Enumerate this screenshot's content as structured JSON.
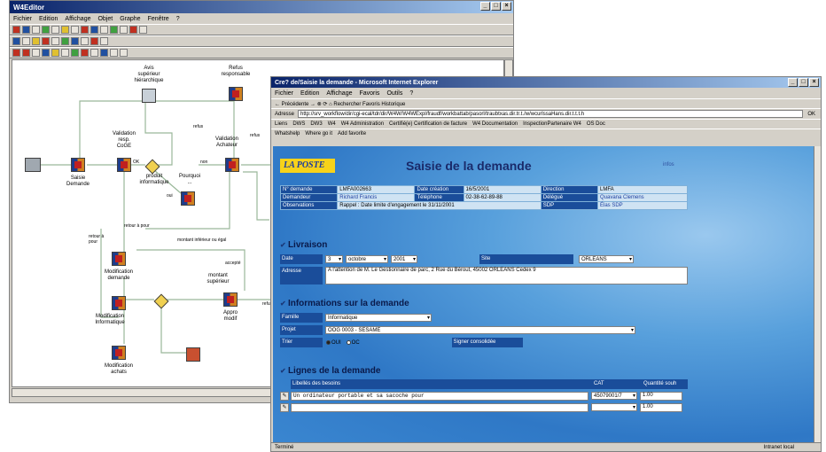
{
  "window1": {
    "title": "W4Editor",
    "menu": [
      "Fichier",
      "Edition",
      "Affichage",
      "Objet",
      "Graphe",
      "Fenêtre",
      "?"
    ],
    "nodes": {
      "saisie": "Saisie\nDemande",
      "validation_resp": "Validation\nresp.\nCoGE",
      "produit": "produit\ninformatique",
      "avis": "Avis\nsupérieur\nhiérarchique",
      "refus_resp": "Refus\nresponsable",
      "validation_achats": "Validation\nAchateur",
      "pourquoi": "Pourquoi\n...",
      "modif_demande": "Modification\ndemande",
      "modif_info": "Modification\nInformatique",
      "appro_modif": "Appro\nmodif",
      "modif_achats": "Modification\nachats",
      "montant": "montant\nsupérieur"
    },
    "edges": {
      "refus": "refus",
      "ok": "OK",
      "non": "non",
      "oui": "oui",
      "retour_a_pour": "retour à pour",
      "retour_a_pour2": "retour à\npour",
      "montant_sup": "montant inférieur ou égal",
      "accepte": "accepté",
      "refus2": "refus",
      "refus3": "refus"
    },
    "side_label": "Cou\nsup\nsi s"
  },
  "window2": {
    "title": "Cre? de/Saisie la demande - Microsoft Internet Explorer",
    "menu": [
      "Fichier",
      "Edition",
      "Affichage",
      "Favoris",
      "Outils",
      "?"
    ],
    "toolbar_text": "← Précédente  →  ⊗  ⟳  ⌂   Rechercher   Favoris   Historique",
    "address_label": "Adresse",
    "address": "http://srv_workflow/dir/cgi-ecal/tdr/dir/W4W/W4WExpl/fraudf/workbattab/pasorl/traubtxas.dir.tr.t./w/wcurlssaHans.dir.t.t.t.h",
    "go": "OK",
    "links": [
      "Liens",
      "DWS",
      "DW3",
      "W4",
      "W4 Administration",
      "Certifié(e) Certification de facture",
      "W4 Documentation",
      "InspectionPartenaire W4",
      "OS Doc"
    ],
    "links2": [
      "Whatshelp",
      "Where go it",
      "Add favorite"
    ],
    "status": "Terminé",
    "zone": "Intranet local"
  },
  "page": {
    "logo": "LA POSTE",
    "title": "Saisie de la demande",
    "small_right": "infos",
    "header_rows": [
      [
        "N° demande",
        "LMFA002663",
        "Date création",
        "16/5/2001",
        "Direction",
        "LMFA"
      ],
      [
        "Demandeur",
        "Richard Francis",
        "Téléphone",
        "02-38-62-89-88",
        "Délégué",
        "Quavana Clemens"
      ],
      [
        "Observations",
        "Rappel : Date limite d'engagement le 31/11/2001",
        "",
        "",
        "SDP",
        "Élas SDP"
      ]
    ],
    "section_livraison": "Livraison",
    "date_label": "Date",
    "date_day": "3",
    "date_month": "octobre",
    "date_year": "2001",
    "site_label": "Site",
    "site_value": "ORLEANS",
    "adresse_label": "Adresse",
    "adresse_value": "A l'attention de M. Le Gestionnaire de parc, 2 Rue du Bérout, 45002 ORLEANS Cedex 9",
    "section_info": "Informations sur la demande",
    "famille_label": "Famille",
    "famille_value": "Informatique",
    "projet_label": "Projet",
    "projet_value": "OOG 0003 - SESAME",
    "trier_label": "Trier",
    "radio_oui": "OUI",
    "radio_oc": "OC",
    "signer_label": "Signer consolidée",
    "section_lignes": "Lignes de la demande",
    "col_libelle": "Libellés des besoins",
    "col_cat": "CAT",
    "col_qte": "Quantité souh",
    "line1_text": "Un ordinateur portable et sa sacoche pour",
    "line1_cat": "45079001/7",
    "line1_qte": "1.00",
    "line2_qte": "1.00"
  }
}
